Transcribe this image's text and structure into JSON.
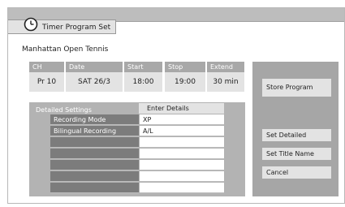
{
  "header": {
    "title": "Timer Program Set",
    "icon": "clock-icon"
  },
  "program": {
    "name": "Manhattan Open Tennis"
  },
  "fields": {
    "ch": {
      "label": "CH",
      "value": "Pr 10"
    },
    "date": {
      "label": "Date",
      "value": "SAT 26/3"
    },
    "start": {
      "label": "Start",
      "value": "18:00"
    },
    "stop": {
      "label": "Stop",
      "value": "19:00"
    },
    "extend": {
      "label": "Extend",
      "value": "30 min"
    }
  },
  "details": {
    "title": "Detailed Settings",
    "enter_label": "Enter Details",
    "rows": [
      {
        "label": "Recording Mode",
        "value": "XP"
      },
      {
        "label": "Bilingual Recording",
        "value": "A/L"
      },
      {
        "label": "",
        "value": ""
      },
      {
        "label": "",
        "value": ""
      },
      {
        "label": "",
        "value": ""
      },
      {
        "label": "",
        "value": ""
      },
      {
        "label": "",
        "value": ""
      }
    ]
  },
  "buttons": {
    "store": "Store Program",
    "set_detailed": "Set Detailed",
    "set_title": "Set Title Name",
    "cancel": "Cancel"
  },
  "colors": {
    "background": "#ffffff",
    "panel": "#a6a6a6",
    "row_label": "#7c7c7c",
    "light_cell": "#e3e3e3"
  }
}
